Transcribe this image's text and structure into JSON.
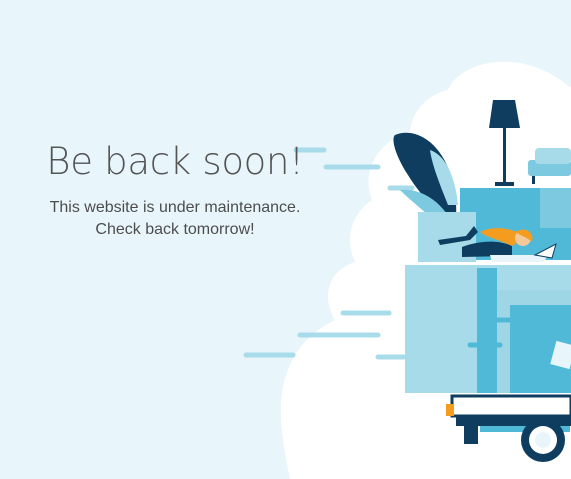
{
  "headline": "Be back soon!",
  "message_line_1": "This website is under maintenance.",
  "message_line_2": "Check back tomorrow!",
  "colors": {
    "background": "#e8f6fc",
    "cloud": "#ffffff",
    "box_light": "#a8dbe9",
    "box_mid": "#51b9d8",
    "navy": "#0f3d5f",
    "hair": "#f39c1f",
    "speed_lines": "#a9dcea"
  },
  "icons": [
    "floor-lamp-icon",
    "plant-leaves-icon",
    "sofa-icon",
    "laptop-icon",
    "truck-wheel-icon"
  ]
}
